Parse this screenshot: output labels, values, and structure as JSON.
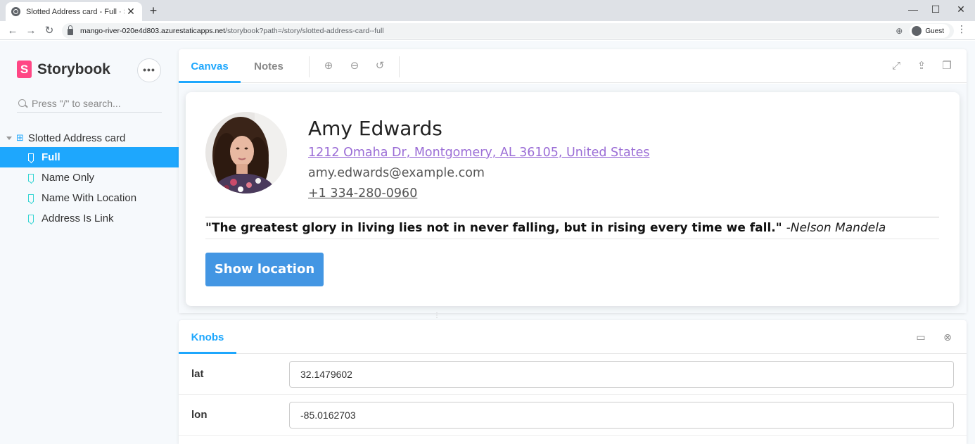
{
  "browser": {
    "tab_title": "Slotted Address card - Full · Storybook",
    "url_host": "mango-river-020e4d803.azurestaticapps.net",
    "url_path": "/storybook?path=/story/slotted-address-card--full",
    "profile_label": "Guest"
  },
  "sidebar": {
    "brand": "Storybook",
    "brand_letter": "S",
    "search_placeholder": "Press \"/\" to search...",
    "group_label": "Slotted Address card",
    "items": [
      {
        "label": "Full",
        "active": true
      },
      {
        "label": "Name Only",
        "active": false
      },
      {
        "label": "Name With Location",
        "active": false
      },
      {
        "label": "Address Is Link",
        "active": false
      }
    ]
  },
  "preview": {
    "tabs": [
      "Canvas",
      "Notes"
    ],
    "card": {
      "name": "Amy Edwards",
      "address": "1212 Omaha Dr, Montgomery, AL 36105, United States",
      "email": "amy.edwards@example.com",
      "phone": "+1 334-280-0960",
      "quote": "\"The greatest glory in living lies not in never falling, but in rising every time we fall.\"",
      "quote_author": "-Nelson Mandela",
      "button_label": "Show location"
    }
  },
  "addons": {
    "tab": "Knobs",
    "knobs": [
      {
        "label": "lat",
        "value": "32.1479602"
      },
      {
        "label": "lon",
        "value": "-85.0162703"
      }
    ]
  },
  "colors": {
    "accent": "#1ea7fd",
    "brand": "#ff4785",
    "button": "#4396e3",
    "link": "#9b6dd6"
  }
}
